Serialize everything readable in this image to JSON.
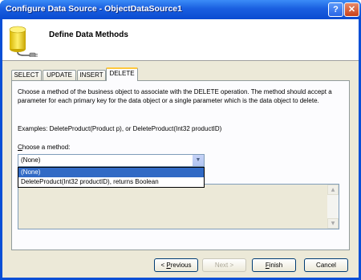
{
  "window": {
    "title": "Configure Data Source - ObjectDataSource1",
    "help_glyph": "?",
    "close_glyph": "✕"
  },
  "header": {
    "title": "Define Data Methods",
    "icon": "database-plug-icon"
  },
  "tabs": [
    {
      "label": "SELECT",
      "active": false
    },
    {
      "label": "UPDATE",
      "active": false
    },
    {
      "label": "INSERT",
      "active": false
    },
    {
      "label": "DELETE",
      "active": true
    }
  ],
  "panel": {
    "description": "Choose a method of the business object to associate with the DELETE operation. The method should accept a parameter for each primary key for the data object or a single parameter which is the data object to delete.",
    "examples": "Examples: DeleteProduct(Product p), or DeleteProduct(Int32 productID)",
    "choose_label_accel": "C",
    "choose_label_rest": "hoose a method:",
    "select_value": "(None)",
    "options": [
      "(None)",
      "DeleteProduct(Int32 productID), returns Boolean"
    ],
    "selected_index": 0
  },
  "buttons": {
    "previous_accel": "P",
    "previous_pre": "< ",
    "previous_rest": "revious",
    "next": "Next >",
    "finish_accel": "F",
    "finish_rest": "inish",
    "cancel": "Cancel"
  },
  "colors": {
    "titlebar": "#0a4bd1",
    "selection": "#316ac5",
    "dialog_bg": "#ece9d8"
  }
}
